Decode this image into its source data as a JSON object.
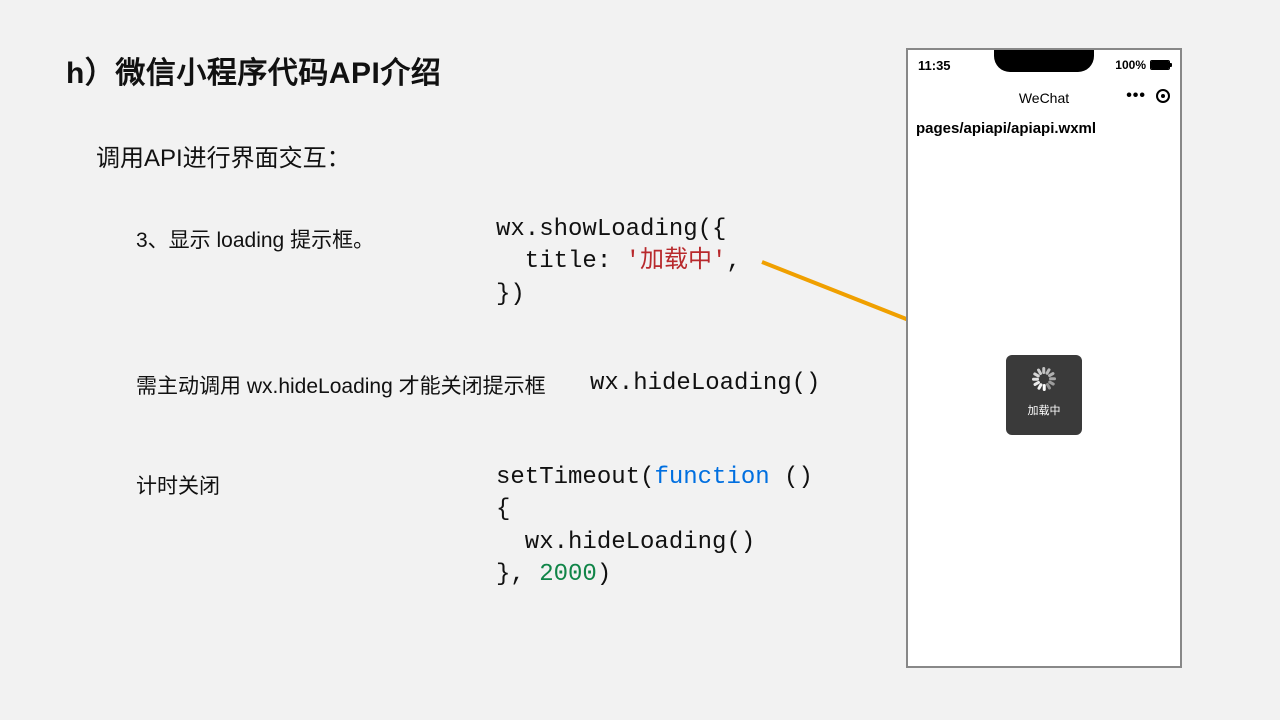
{
  "title": "h）微信小程序代码API介绍",
  "subtitle": "调用API进行界面交互：",
  "row1": {
    "label": "3、显示 loading 提示框。"
  },
  "code1": {
    "l1": "wx.showLoading({",
    "l2a": "  title: ",
    "l2b": "'加载中'",
    "l2c": ",",
    "l3": "})"
  },
  "row2": {
    "label": "需主动调用 wx.hideLoading 才能关闭提示框",
    "code": "wx.hideLoading()"
  },
  "row3": {
    "label": "计时关闭"
  },
  "code3": {
    "l1a": "setTimeout(",
    "l1b": "function",
    "l1c": " ()",
    "l2": "{",
    "l3": "  wx.hideLoading()",
    "l4a": "}, ",
    "l4b": "2000",
    "l4c": ")"
  },
  "phone": {
    "time": "11:35",
    "battery": "100%",
    "app_title": "WeChat",
    "page_path": "pages/apiapi/apiapi.wxml",
    "toast_text": "加载中"
  }
}
